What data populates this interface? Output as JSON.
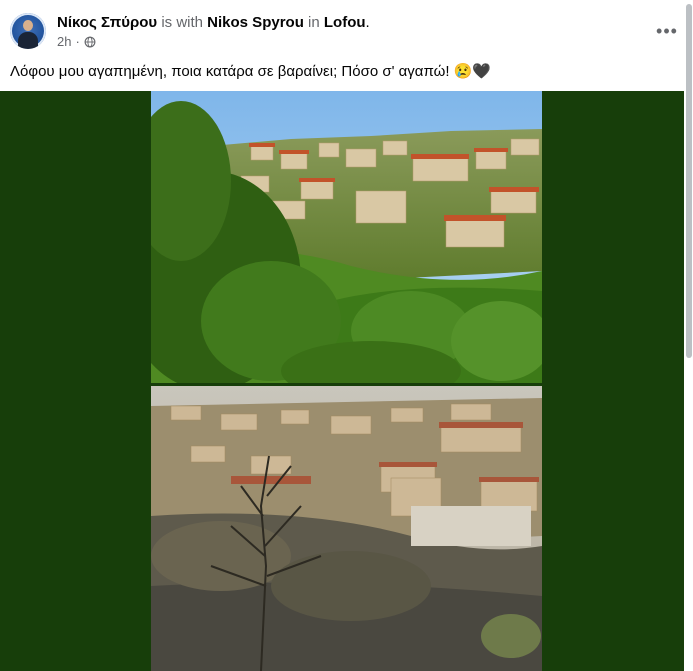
{
  "post": {
    "author": "Νίκος Σπύρου",
    "with_text": "is with",
    "tagged": "Nikos Spyrou",
    "in_text": "in",
    "location": "Lofou",
    "period": ".",
    "time": "2h",
    "dot": "·",
    "privacy_icon": "globe-icon",
    "more_label": "•••",
    "caption": "Λόφου μου αγαπημένη, ποια κατάρα σε βαραίνει; Πόσο σ' αγαπώ! 😢🖤"
  },
  "media": {
    "background_color": "#173e0a",
    "photos": [
      {
        "label": "village-before-fire"
      },
      {
        "label": "village-after-fire"
      }
    ]
  }
}
